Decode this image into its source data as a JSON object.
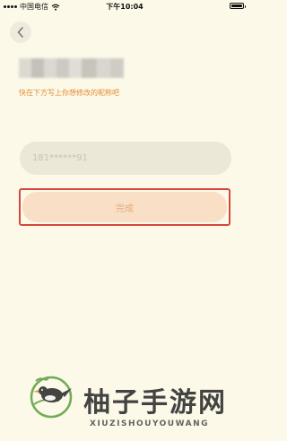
{
  "status_bar": {
    "carrier": "中国电信",
    "time": "下午10:04"
  },
  "header": {
    "back_icon": "chevron-left-icon"
  },
  "form": {
    "hint": "快在下方写上你想修改的昵称吧",
    "input_placeholder": "181******91",
    "submit_label": "完成"
  },
  "watermark": {
    "title": "柚子手游网",
    "subtitle": "XIUZISHOUYOUWANG"
  },
  "colors": {
    "background": "#fdf9e9",
    "hint_text": "#e08d33",
    "input_bg": "#ece8d8",
    "button_bg": "#f9dfc6",
    "button_text": "#e8a87a",
    "highlight_border": "#d6473c"
  }
}
